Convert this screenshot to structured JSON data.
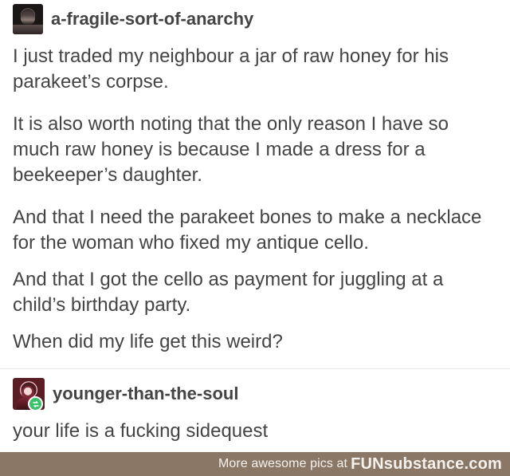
{
  "post": {
    "author": "a-fragile-sort-of-anarchy",
    "paragraphs": [
      "I just traded my neighbour a jar of raw honey for his parakeet’s corpse.",
      "It is also worth noting that the only reason I have so much raw honey is because I made a dress for a beekeeper’s daughter.",
      "And that I need the parakeet bones to make a necklace for the woman who fixed my antique cello.",
      "And that I got the cello as payment for juggling at a child’s birthday party.",
      "When did my life get this weird?"
    ]
  },
  "reply": {
    "author": "younger-than-the-soul",
    "text": "your life is a fucking sidequest",
    "badge_icon": "reblog-icon",
    "badge_color": "#39c16c"
  },
  "footer": {
    "prefix": "More awesome pics at ",
    "brand_prefix": "FUN",
    "brand_suffix": "substance",
    "brand_tld": ".com",
    "background": "#8b7766"
  }
}
